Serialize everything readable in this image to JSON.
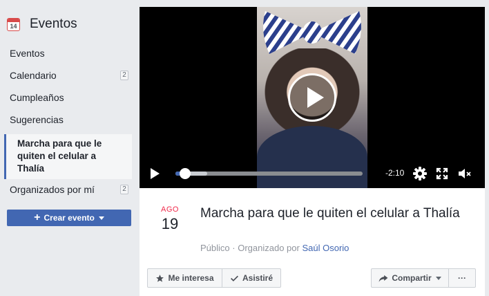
{
  "app": {
    "title": "Eventos",
    "icon": "calendar-icon",
    "icon_number": "14"
  },
  "sidebar": {
    "items": [
      {
        "label": "Eventos",
        "count": ""
      },
      {
        "label": "Calendario",
        "count": "2"
      },
      {
        "label": "Cumpleaños",
        "count": ""
      },
      {
        "label": "Sugerencias",
        "count": ""
      },
      {
        "label": "Marcha para que le quiten el celular a Thalía",
        "count": "",
        "active": true
      },
      {
        "label": "Organizados por mí",
        "count": "2"
      }
    ],
    "create_button": "Crear evento"
  },
  "video": {
    "time_remaining": "-2:10",
    "progress_fraction": 0.05,
    "buffered_fraction": 0.17,
    "icons": [
      "play-icon",
      "settings-gear-icon",
      "fullscreen-icon",
      "volume-muted-icon"
    ]
  },
  "event": {
    "month": "AGO",
    "day": "19",
    "title": "Marcha para que le quiten el celular a Thalía",
    "privacy": "Público",
    "separator": "·",
    "organized_by_prefix": "Organizado por",
    "organizer": "Saúl Osorio"
  },
  "actions": {
    "interested": "Me interesa",
    "going": "Asistiré",
    "share": "Compartir",
    "more": "···"
  },
  "colors": {
    "accent": "#4267b2",
    "month_red": "#f02849",
    "background": "#e9ebee"
  }
}
